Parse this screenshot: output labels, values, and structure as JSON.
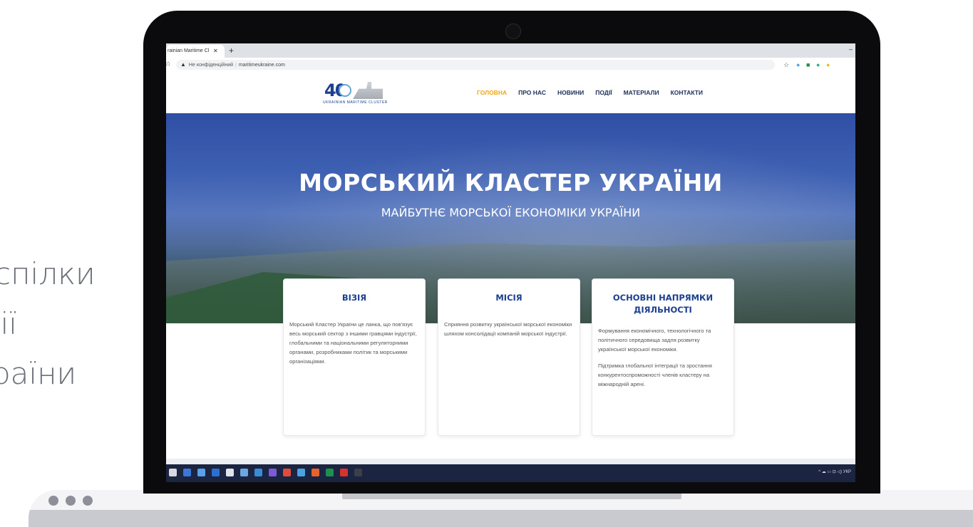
{
  "side_text": [
    "спілки",
    "ції",
    "раїни"
  ],
  "browser": {
    "tab_title": "rainian Maritime Cl",
    "tab_close": "✕",
    "new_tab": "+",
    "minimize": "–",
    "security_label": "Не конфіденційний",
    "url": "maritimeukraine.com",
    "home_icon": "⌂",
    "warn_icon": "▲",
    "star_icon": "☆"
  },
  "site": {
    "logo": {
      "number": "40",
      "text": "UKRAINIAN MARITIME CLUSTER"
    },
    "nav": [
      "ГОЛОВНА",
      "ПРО НАС",
      "НОВИНИ",
      "ПОДІЇ",
      "МАТЕРІАЛИ",
      "КОНТАКТИ"
    ],
    "hero": {
      "title": "МОРСЬКИЙ КЛАСТЕР УКРАЇНИ",
      "subtitle": "МАЙБУТНЄ МОРСЬКОЇ ЕКОНОМІКИ УКРАЇНИ"
    },
    "cards": [
      {
        "title": "ВІЗІЯ",
        "paragraphs": [
          "Морський Кластер України це ланка, що пов'язує весь морський сектор з іншими гравцями індустрії, глобальними та  національними регуляторними органами, розробниками політик та морськими організаціями."
        ]
      },
      {
        "title": "МІСІЯ",
        "paragraphs": [
          "Сприяння розвитку української морської економіки шляхом консолідації  компаній морської індустрії."
        ]
      },
      {
        "title": "ОСНОВНІ НАПРЯМКИ ДІЯЛЬНОСТІ",
        "paragraphs": [
          "Формування економічного, технологічного та політичного середовища задля розвитку української морської економіки.",
          "Підтримка глобальної інтеграції та зростання конкурентоспроможності членів кластеру на міжнародній арені."
        ]
      }
    ]
  },
  "taskbar": {
    "tray_text": "УКР",
    "icon_colors": [
      "#d6d9e0",
      "#3a78d8",
      "#5aa0e8",
      "#2d6fd0",
      "#e0e4ea",
      "#6aa7e0",
      "#3b8ad6",
      "#7b5bd6",
      "#e24b3b",
      "#4aa3df",
      "#e8622c",
      "#1f8f4e",
      "#d8322c",
      "#3a3f4a"
    ]
  },
  "colors": {
    "nav_active": "#f0a71e",
    "nav_default": "#1d2f5a",
    "card_title": "#1d3f8f",
    "hero_blue": "#3e60b2"
  }
}
